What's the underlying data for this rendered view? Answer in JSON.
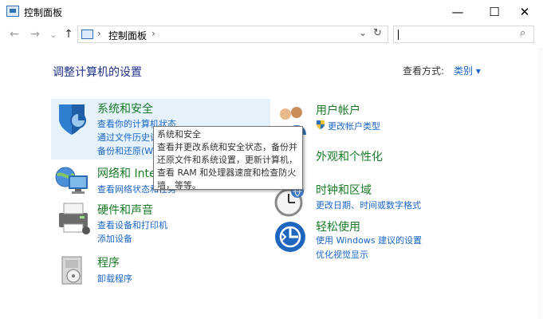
{
  "window": {
    "title": "控制面板",
    "minimize": "—",
    "maximize": "☐",
    "close": "✕"
  },
  "nav": {
    "back": "←",
    "forward": "→",
    "recent": "⌄",
    "up": "↑",
    "breadcrumb_sep": "›",
    "breadcrumb": "控制面板",
    "breadcrumb_end": "›",
    "dropdown": "⌄",
    "refresh": "↻",
    "search_value": "",
    "search_icon": "⌕"
  },
  "header": {
    "title": "调整计算机的设置",
    "view_by": "查看方式:",
    "view_mode": "类别 ▾"
  },
  "left": [
    {
      "title": "系统和安全",
      "icon": "shield-icon",
      "links": [
        "查看你的计算机状态",
        "通过文件历史记录保存你的文件备份副本",
        "备份和还原(Windows 7)"
      ]
    },
    {
      "title": "网络和 Internet",
      "icon": "network-icon",
      "links": [
        "查看网络状态和任务"
      ]
    },
    {
      "title": "硬件和声音",
      "icon": "printer-icon",
      "links": [
        "查看设备和打印机",
        "添加设备"
      ]
    },
    {
      "title": "程序",
      "icon": "programs-icon",
      "links": [
        "卸载程序"
      ]
    }
  ],
  "right": [
    {
      "title": "用户帐户",
      "icon": "users-icon",
      "links": [
        "更改帐户类型"
      ]
    },
    {
      "title": "外观和个性化",
      "icon": "appearance-icon",
      "links": []
    },
    {
      "title": "时钟和区域",
      "icon": "clock-icon",
      "links": [
        "更改日期、时间或数字格式"
      ]
    },
    {
      "title": "轻松使用",
      "icon": "ease-of-access-icon",
      "links": [
        "使用 Windows 建议的设置",
        "优化视觉显示"
      ]
    }
  ],
  "tooltip": {
    "title": "系统和安全",
    "lines": [
      "查看并更改系统和安全状态，备份并",
      "还原文件和系统设置，更新计算机，",
      "查看 RAM 和处理器速度和检查防火",
      "墙，等等。"
    ]
  },
  "colors": {
    "category_title": "#187a27",
    "link": "#1a66c7",
    "header": "#1e3287",
    "highlight": "#e5f2fc"
  }
}
